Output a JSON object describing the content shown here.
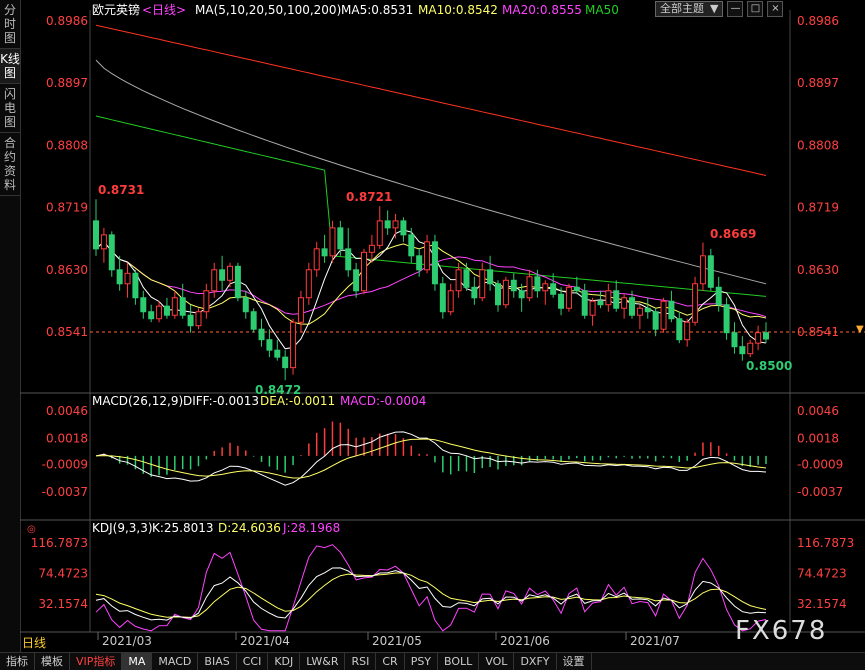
{
  "sidebar": {
    "tabs": [
      "分时图",
      "K线图",
      "闪电图",
      "合约资料"
    ],
    "active": 1
  },
  "header": {
    "symbol": "欧元英镑",
    "period": "<日线>",
    "ma_label": "MA(5,10,20,50,100,200)",
    "ma5": "MA5:0.8531",
    "ma10": "MA10:0.8542",
    "ma20": "MA20:0.8555",
    "ma50": "MA50"
  },
  "top_controls": {
    "theme_label": "全部主题",
    "theme_arrow": "▼",
    "min": "—",
    "restore": "□",
    "close": "×"
  },
  "price_axis": {
    "ticks": [
      "0.8986",
      "0.8897",
      "0.8808",
      "0.8719",
      "0.8630",
      "0.8541"
    ],
    "current": "0.8541"
  },
  "annotations": {
    "high1": "0.8731",
    "high2": "0.8721",
    "high3": "0.8669",
    "low1": "0.8472",
    "low2": "0.8500"
  },
  "macd_panel": {
    "label": "MACD(26,12,9)",
    "diff": "DIFF:-0.0013",
    "dea": "DEA:-0.0011",
    "macd": "MACD:-0.0004",
    "ticks": [
      "0.0046",
      "0.0018",
      "-0.0009",
      "-0.0037"
    ]
  },
  "kdj_panel": {
    "label": "KDJ(9,3,3)",
    "k": "K:25.8013",
    "d": "D:24.6036",
    "j": "J:28.1968",
    "ticks": [
      "116.7873",
      "74.4723",
      "32.1574"
    ]
  },
  "date_axis": [
    "2021/03",
    "2021/04",
    "2021/05",
    "2021/06",
    "2021/07"
  ],
  "period_selector": "日线",
  "watermark": "FX678",
  "bottom_tabs": [
    "指标",
    "模板",
    "VIP指标",
    "MA",
    "MACD",
    "BIAS",
    "CCI",
    "KDJ",
    "LW&R",
    "RSI",
    "CR",
    "PSY",
    "BOLL",
    "VOL",
    "DXFY",
    "设置"
  ],
  "bottom_active": "MA",
  "colors": {
    "up": "#ff3b3b",
    "down": "#2ecc71",
    "ma5": "#ffffff",
    "ma10": "#ffff66",
    "ma20": "#ff44ff",
    "ma50": "#22cc22",
    "ma100": "#aaaaaa",
    "ma200": "#ff3322",
    "axis": "#ff4040"
  },
  "chart_data": {
    "type": "candlestick",
    "price_range": [
      0.845,
      0.8986
    ],
    "x_period": "2021/03 – 2021/07",
    "candles": [
      [
        0.87,
        0.8731,
        0.865,
        0.866
      ],
      [
        0.866,
        0.869,
        0.864,
        0.868
      ],
      [
        0.868,
        0.8685,
        0.862,
        0.863
      ],
      [
        0.863,
        0.865,
        0.86,
        0.861
      ],
      [
        0.861,
        0.864,
        0.859,
        0.8625
      ],
      [
        0.8625,
        0.863,
        0.858,
        0.859
      ],
      [
        0.859,
        0.86,
        0.856,
        0.857
      ],
      [
        0.857,
        0.858,
        0.8555,
        0.856
      ],
      [
        0.856,
        0.8585,
        0.8555,
        0.8578
      ],
      [
        0.8578,
        0.859,
        0.856,
        0.8565
      ],
      [
        0.8565,
        0.86,
        0.856,
        0.859
      ],
      [
        0.859,
        0.861,
        0.856,
        0.8565
      ],
      [
        0.8565,
        0.858,
        0.854,
        0.855
      ],
      [
        0.855,
        0.8575,
        0.8545,
        0.857
      ],
      [
        0.857,
        0.861,
        0.856,
        0.86
      ],
      [
        0.86,
        0.864,
        0.859,
        0.863
      ],
      [
        0.863,
        0.865,
        0.86,
        0.8615
      ],
      [
        0.8615,
        0.864,
        0.8605,
        0.8635
      ],
      [
        0.8635,
        0.864,
        0.8585,
        0.859
      ],
      [
        0.859,
        0.86,
        0.856,
        0.857
      ],
      [
        0.857,
        0.8575,
        0.854,
        0.8545
      ],
      [
        0.8545,
        0.856,
        0.852,
        0.853
      ],
      [
        0.853,
        0.8545,
        0.8505,
        0.8515
      ],
      [
        0.8515,
        0.853,
        0.85,
        0.8505
      ],
      [
        0.8505,
        0.8515,
        0.8472,
        0.849
      ],
      [
        0.849,
        0.856,
        0.848,
        0.8555
      ],
      [
        0.8555,
        0.86,
        0.854,
        0.859
      ],
      [
        0.859,
        0.864,
        0.858,
        0.863
      ],
      [
        0.863,
        0.867,
        0.862,
        0.866
      ],
      [
        0.866,
        0.868,
        0.864,
        0.865
      ],
      [
        0.865,
        0.87,
        0.864,
        0.869
      ],
      [
        0.869,
        0.87,
        0.865,
        0.866
      ],
      [
        0.866,
        0.869,
        0.862,
        0.863
      ],
      [
        0.863,
        0.864,
        0.859,
        0.86
      ],
      [
        0.86,
        0.866,
        0.8595,
        0.8655
      ],
      [
        0.8655,
        0.868,
        0.864,
        0.8665
      ],
      [
        0.8665,
        0.8721,
        0.866,
        0.87
      ],
      [
        0.87,
        0.8715,
        0.868,
        0.869
      ],
      [
        0.869,
        0.871,
        0.8675,
        0.87
      ],
      [
        0.87,
        0.8705,
        0.867,
        0.868
      ],
      [
        0.868,
        0.869,
        0.864,
        0.865
      ],
      [
        0.865,
        0.866,
        0.862,
        0.863
      ],
      [
        0.863,
        0.868,
        0.8625,
        0.867
      ],
      [
        0.867,
        0.868,
        0.86,
        0.861
      ],
      [
        0.861,
        0.862,
        0.856,
        0.857
      ],
      [
        0.857,
        0.861,
        0.8565,
        0.86
      ],
      [
        0.86,
        0.864,
        0.859,
        0.863
      ],
      [
        0.863,
        0.864,
        0.86,
        0.8605
      ],
      [
        0.8605,
        0.862,
        0.858,
        0.859
      ],
      [
        0.859,
        0.864,
        0.8585,
        0.863
      ],
      [
        0.863,
        0.865,
        0.86,
        0.861
      ],
      [
        0.861,
        0.8615,
        0.857,
        0.858
      ],
      [
        0.858,
        0.862,
        0.8575,
        0.8615
      ],
      [
        0.8615,
        0.8625,
        0.859,
        0.86
      ],
      [
        0.86,
        0.861,
        0.857,
        0.859
      ],
      [
        0.859,
        0.863,
        0.8585,
        0.862
      ],
      [
        0.862,
        0.863,
        0.859,
        0.86
      ],
      [
        0.86,
        0.8615,
        0.858,
        0.861
      ],
      [
        0.861,
        0.8625,
        0.859,
        0.8595
      ],
      [
        0.8595,
        0.8605,
        0.8565,
        0.8575
      ],
      [
        0.8575,
        0.861,
        0.857,
        0.8605
      ],
      [
        0.8605,
        0.862,
        0.8595,
        0.86
      ],
      [
        0.86,
        0.861,
        0.856,
        0.8565
      ],
      [
        0.8565,
        0.859,
        0.855,
        0.8585
      ],
      [
        0.8585,
        0.86,
        0.8575,
        0.858
      ],
      [
        0.858,
        0.861,
        0.857,
        0.86
      ],
      [
        0.86,
        0.8615,
        0.857,
        0.8575
      ],
      [
        0.8575,
        0.8595,
        0.856,
        0.859
      ],
      [
        0.859,
        0.86,
        0.856,
        0.8565
      ],
      [
        0.8565,
        0.858,
        0.8545,
        0.8575
      ],
      [
        0.8575,
        0.859,
        0.856,
        0.857
      ],
      [
        0.857,
        0.8575,
        0.8535,
        0.8545
      ],
      [
        0.8545,
        0.859,
        0.854,
        0.8585
      ],
      [
        0.8585,
        0.86,
        0.8555,
        0.856
      ],
      [
        0.856,
        0.857,
        0.8525,
        0.853
      ],
      [
        0.853,
        0.856,
        0.852,
        0.8555
      ],
      [
        0.8555,
        0.862,
        0.855,
        0.861
      ],
      [
        0.861,
        0.8669,
        0.86,
        0.865
      ],
      [
        0.865,
        0.866,
        0.86,
        0.8605
      ],
      [
        0.8605,
        0.862,
        0.857,
        0.858
      ],
      [
        0.858,
        0.859,
        0.853,
        0.854
      ],
      [
        0.854,
        0.8555,
        0.851,
        0.852
      ],
      [
        0.852,
        0.8535,
        0.85,
        0.851
      ],
      [
        0.851,
        0.853,
        0.8505,
        0.8525
      ],
      [
        0.8525,
        0.855,
        0.8515,
        0.854
      ],
      [
        0.854,
        0.8555,
        0.8525,
        0.8531
      ]
    ]
  }
}
